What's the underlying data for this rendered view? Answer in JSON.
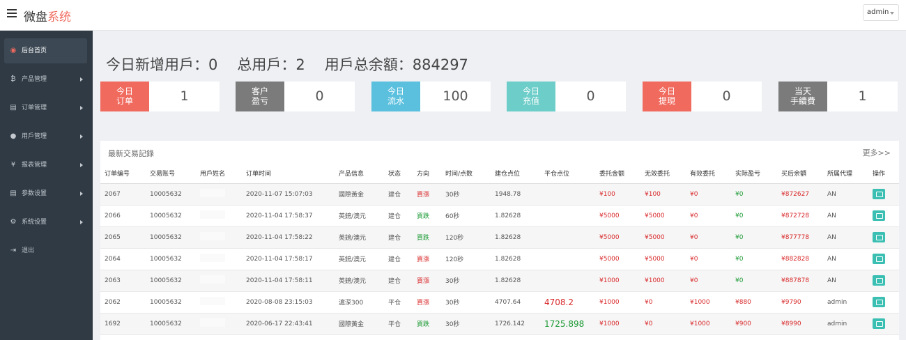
{
  "app": {
    "brand_main": "微盘",
    "brand_accent": "系统",
    "user_menu": "admin"
  },
  "sidebar": {
    "items": [
      {
        "label": "后台首页",
        "icon": "dashboard-icon",
        "glyph": "◉"
      },
      {
        "label": "产品管理",
        "icon": "bitcoin-icon",
        "glyph": "₿"
      },
      {
        "label": "订单管理",
        "icon": "copy-icon",
        "glyph": "▤"
      },
      {
        "label": "用戶管理",
        "icon": "user-icon",
        "glyph": "●"
      },
      {
        "label": "报表管理",
        "icon": "yen-icon",
        "glyph": "¥"
      },
      {
        "label": "参数设置",
        "icon": "copy-icon",
        "glyph": "▤"
      },
      {
        "label": "系统设置",
        "icon": "gears-icon",
        "glyph": "⚙"
      },
      {
        "label": "退出",
        "icon": "sign-out-icon",
        "glyph": "⇥"
      }
    ]
  },
  "summary": {
    "new_users": "今日新增用戶：0",
    "total_users": "总用戶：2",
    "total_balance": "用戶总余額：884297"
  },
  "stats": [
    {
      "label1": "今日",
      "label2": "订单",
      "value": "1",
      "color": "#f06a5e"
    },
    {
      "label1": "客户",
      "label2": "盈亏",
      "value": "0",
      "color": "#7b7b7b"
    },
    {
      "label1": "今日",
      "label2": "流水",
      "value": "100",
      "color": "#5bc0de"
    },
    {
      "label1": "今日",
      "label2": "充值",
      "value": "0",
      "color": "#6dcdc9"
    },
    {
      "label1": "今日",
      "label2": "提現",
      "value": "0",
      "color": "#f06a5e"
    },
    {
      "label1": "当天",
      "label2": "手續費",
      "value": "1",
      "color": "#7b7b7b"
    }
  ],
  "panel": {
    "title": "最新交易記錄",
    "more": "更多>>"
  },
  "table": {
    "headers": [
      "订单编号",
      "交易账号",
      "用戶姓名",
      "订单时间",
      "产品信息",
      "状态",
      "方向",
      "时间/点数",
      "建仓点位",
      "平仓点位",
      "委托金额",
      "无效委托",
      "有效委托",
      "实际盈亏",
      "买后余額",
      "所属代理",
      "操作"
    ],
    "rows": [
      {
        "id": "2067",
        "account": "10005632",
        "time": "2020-11-07 15:07:03",
        "product": "國際黃金",
        "status": "建仓",
        "dir": "買漲",
        "dir_color": "red",
        "period": "30秒",
        "open": "1948.78",
        "close": "",
        "close_color": "",
        "amount": "¥100",
        "invalid": "¥100",
        "valid": "¥0",
        "pnl": "¥0",
        "pnl_color": "green",
        "balance": "¥872627",
        "agent": "AN"
      },
      {
        "id": "2066",
        "account": "10005632",
        "time": "2020-11-04 17:58:37",
        "product": "英鎊/澳元",
        "status": "建仓",
        "dir": "買跌",
        "dir_color": "green",
        "period": "60秒",
        "open": "1.82628",
        "close": "",
        "close_color": "",
        "amount": "¥5000",
        "invalid": "¥5000",
        "valid": "¥0",
        "pnl": "¥0",
        "pnl_color": "green",
        "balance": "¥872728",
        "agent": "AN"
      },
      {
        "id": "2065",
        "account": "10005632",
        "time": "2020-11-04 17:58:22",
        "product": "英鎊/澳元",
        "status": "建仓",
        "dir": "買跌",
        "dir_color": "green",
        "period": "120秒",
        "open": "1.82628",
        "close": "",
        "close_color": "",
        "amount": "¥5000",
        "invalid": "¥5000",
        "valid": "¥0",
        "pnl": "¥0",
        "pnl_color": "green",
        "balance": "¥877778",
        "agent": "AN"
      },
      {
        "id": "2064",
        "account": "10005632",
        "time": "2020-11-04 17:58:17",
        "product": "英鎊/澳元",
        "status": "建仓",
        "dir": "買漲",
        "dir_color": "red",
        "period": "120秒",
        "open": "1.82628",
        "close": "",
        "close_color": "",
        "amount": "¥5000",
        "invalid": "¥5000",
        "valid": "¥0",
        "pnl": "¥0",
        "pnl_color": "green",
        "balance": "¥882828",
        "agent": "AN"
      },
      {
        "id": "2063",
        "account": "10005632",
        "time": "2020-11-04 17:58:11",
        "product": "英鎊/澳元",
        "status": "建仓",
        "dir": "買漲",
        "dir_color": "red",
        "period": "30秒",
        "open": "1.82628",
        "close": "",
        "close_color": "",
        "amount": "¥1000",
        "invalid": "¥1000",
        "valid": "¥0",
        "pnl": "¥0",
        "pnl_color": "green",
        "balance": "¥887878",
        "agent": "AN"
      },
      {
        "id": "2062",
        "account": "10005632",
        "time": "2020-08-08 23:15:03",
        "product": "滬深300",
        "status": "平仓",
        "dir": "買漲",
        "dir_color": "red",
        "period": "30秒",
        "open": "4707.64",
        "close": "4708.2",
        "close_color": "bigred",
        "amount": "¥1000",
        "invalid": "¥0",
        "valid": "¥1000",
        "pnl": "¥880",
        "pnl_color": "red",
        "balance": "¥9790",
        "agent": "admin"
      },
      {
        "id": "1692",
        "account": "10005632",
        "time": "2020-06-17 22:43:41",
        "product": "國際黃金",
        "status": "平仓",
        "dir": "買跌",
        "dir_color": "green",
        "period": "30秒",
        "open": "1726.142",
        "close": "1725.898",
        "close_color": "biggreen",
        "amount": "¥1000",
        "invalid": "¥0",
        "valid": "¥1000",
        "pnl": "¥900",
        "pnl_color": "red",
        "balance": "¥8990",
        "agent": "admin"
      }
    ]
  }
}
